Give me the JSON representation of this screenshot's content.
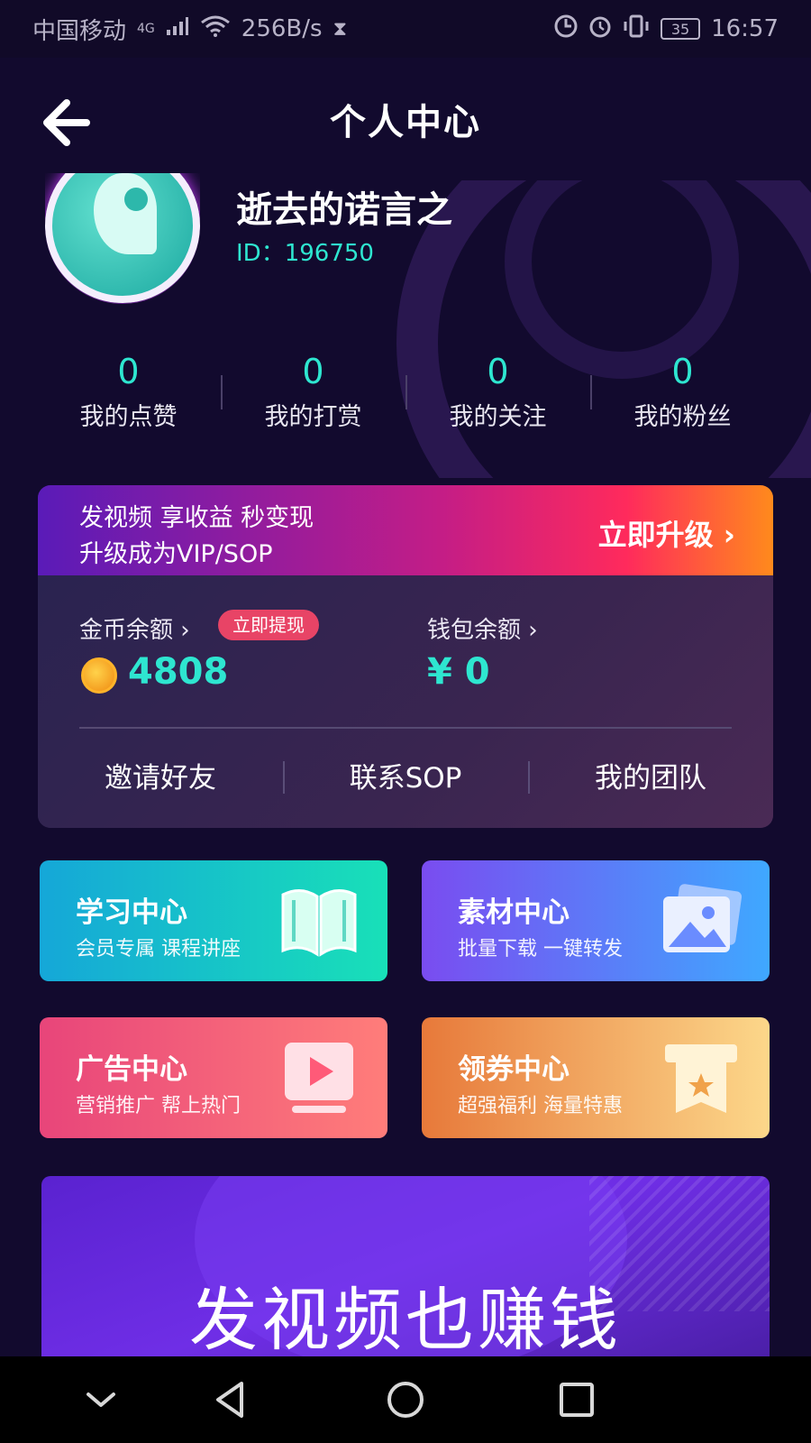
{
  "status_bar": {
    "carrier": "中国移动",
    "network": "4G",
    "speed": "256B/s",
    "battery": "35",
    "time": "16:57"
  },
  "header": {
    "title": "个人中心"
  },
  "profile": {
    "username": "逝去的诺言之",
    "user_id": "ID：196750"
  },
  "stats": [
    {
      "value": "0",
      "label": "我的点赞"
    },
    {
      "value": "0",
      "label": "我的打赏"
    },
    {
      "value": "0",
      "label": "我的关注"
    },
    {
      "value": "0",
      "label": "我的粉丝"
    }
  ],
  "vip": {
    "line1": "发视频 享收益 秒变现",
    "line2": "升级成为VIP/SOP",
    "upgrade": "立即升级 ›"
  },
  "wallet": {
    "coin_label": "金币余额 ›",
    "withdraw": "立即提现",
    "coin_value": "4808",
    "wallet_label": "钱包余额 ›",
    "wallet_value": "¥ 0"
  },
  "actions": [
    "邀请好友",
    "联系SOP",
    "我的团队"
  ],
  "tiles": [
    {
      "title": "学习中心",
      "subtitle": "会员专属 课程讲座",
      "icon": "book-icon"
    },
    {
      "title": "素材中心",
      "subtitle": "批量下载 一键转发",
      "icon": "image-icon"
    },
    {
      "title": "广告中心",
      "subtitle": "营销推广 帮上热门",
      "icon": "play-icon"
    },
    {
      "title": "领券中心",
      "subtitle": "超强福利 海量特惠",
      "icon": "coupon-icon"
    }
  ],
  "promo": {
    "text": "发视频也赚钱"
  },
  "colors": {
    "accent": "#2ee6d0",
    "background": "#120a2e"
  }
}
